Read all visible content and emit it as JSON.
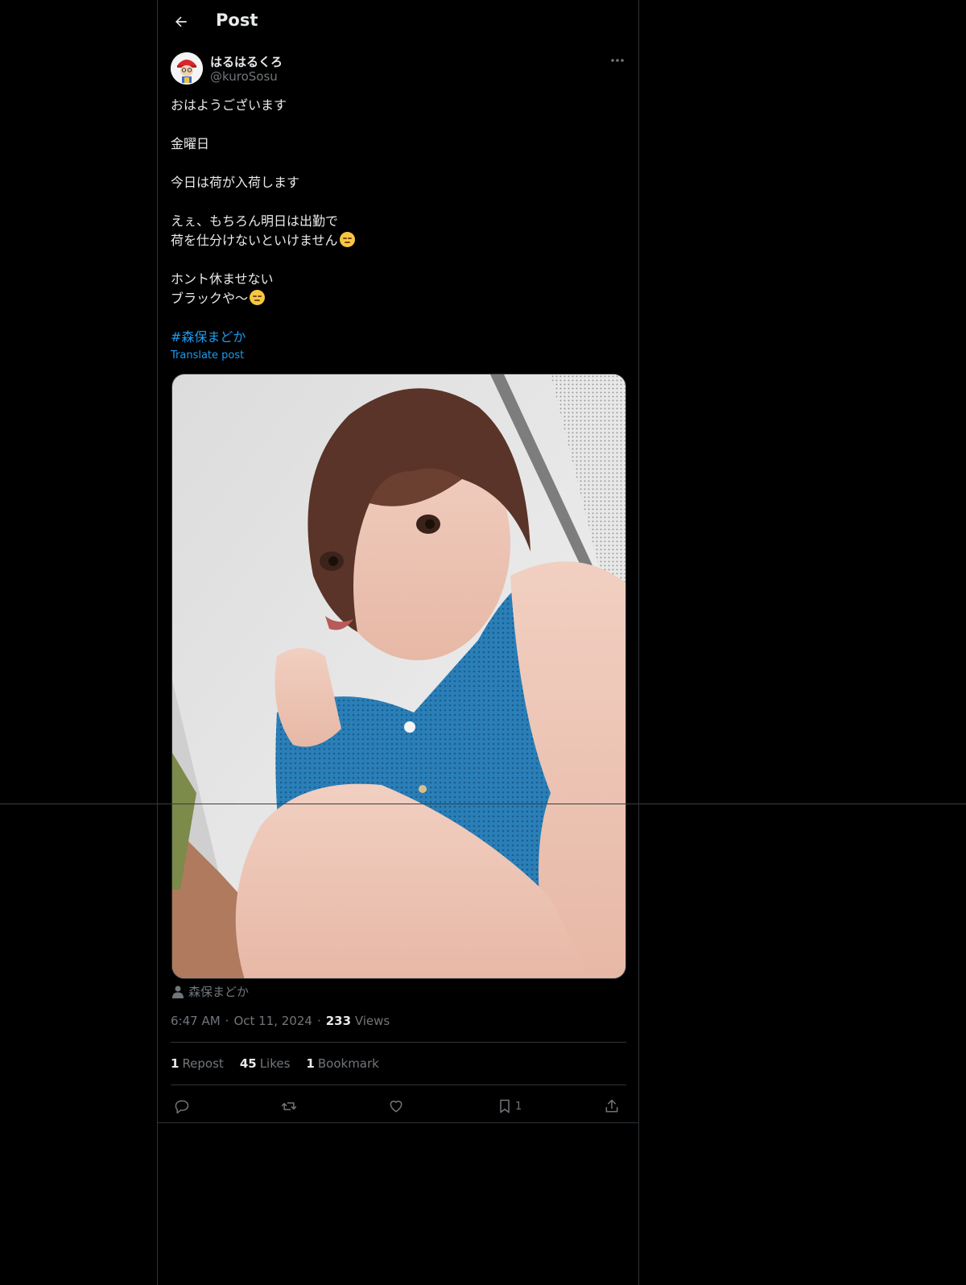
{
  "header": {
    "title": "Post"
  },
  "author": {
    "display_name": "はるはるくろ",
    "handle": "@kuroSosu"
  },
  "post": {
    "lines": [
      "おはようございます",
      "",
      "金曜日",
      "",
      "今日は荷が入荷します",
      "",
      "えぇ、もちろん明日は出勤で",
      "荷を仕分けないといけません",
      "",
      "ホント休ませない",
      "ブラックや〜",
      ""
    ],
    "hashtag": "#森保まどか",
    "translate_label": "Translate post"
  },
  "media": {
    "tagged_person": "森保まどか"
  },
  "meta": {
    "time": "6:47 AM",
    "date": "Oct 11, 2024",
    "views_count": "233",
    "views_label": "Views"
  },
  "stats": {
    "reposts_count": "1",
    "reposts_label": "Repost",
    "likes_count": "45",
    "likes_label": "Likes",
    "bookmarks_count": "1",
    "bookmarks_label": "Bookmark"
  },
  "actions": {
    "bookmark_count": "1"
  },
  "colors": {
    "accent": "#1d9bf0",
    "background": "#000000",
    "secondary_text": "#71767b",
    "border": "#2f3336"
  },
  "icons": [
    "back-arrow-icon",
    "more-icon",
    "person-icon",
    "reply-icon",
    "repost-icon",
    "like-icon",
    "bookmark-icon",
    "share-icon"
  ]
}
